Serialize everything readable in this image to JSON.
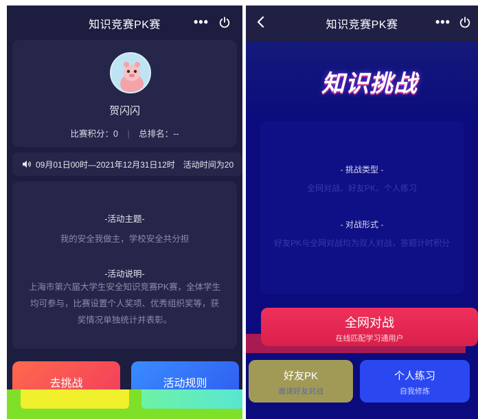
{
  "left": {
    "navbar": {
      "title": "知识竞赛PK赛",
      "more": "•••"
    },
    "profile": {
      "name": "贺闪闪",
      "score_label": "比赛积分：",
      "score": "0",
      "rank_label": "总排名：",
      "rank": "--"
    },
    "notice": {
      "text": "09月01日00时—2021年12月31日12时　活动时间为20"
    },
    "info": {
      "theme_title": "-活动主题-",
      "theme_text": "我的安全我做主，学校安全共分担",
      "desc_title": "-活动说明-",
      "desc_text": "上海市第六届大学生安全知识竞赛PK赛，全体学生均可参与，比赛设置个人奖项、优秀组织奖等，获奖情况单独统计并表彰。"
    },
    "buttons": {
      "challenge": "去挑战",
      "rules": "活动规则"
    }
  },
  "right": {
    "navbar": {
      "title": "知识竞赛PK赛",
      "more": "•••"
    },
    "banner_title": "知识挑战",
    "panel": {
      "type_title": "- 挑战类型 -",
      "type_text": "全网对战、好友PK、个人练习",
      "mode_title": "- 对战形式 -",
      "mode_text": "好友PK与全网对战均为双人对战，答题计时积分"
    },
    "buttons": {
      "global": "全网对战",
      "global_sub": "在线匹配学习通用户",
      "friend": "好友PK",
      "friend_sub": "邀请好友对战",
      "practice": "个人练习",
      "practice_sub": "自我修炼"
    }
  },
  "colors": {
    "left_bg": "#1d1d40",
    "card_bg": "#25264a",
    "right_bg": "#0b0b7d",
    "challenge_btn": "#f23d5c",
    "rules_btn": "#3a8cff",
    "global_btn": "#f0305c",
    "friend_btn": "#a19a57",
    "practice_btn": "#2b47f0"
  },
  "icons": [
    "more-icon",
    "power-icon",
    "back-icon",
    "speaker-icon",
    "avatar"
  ]
}
